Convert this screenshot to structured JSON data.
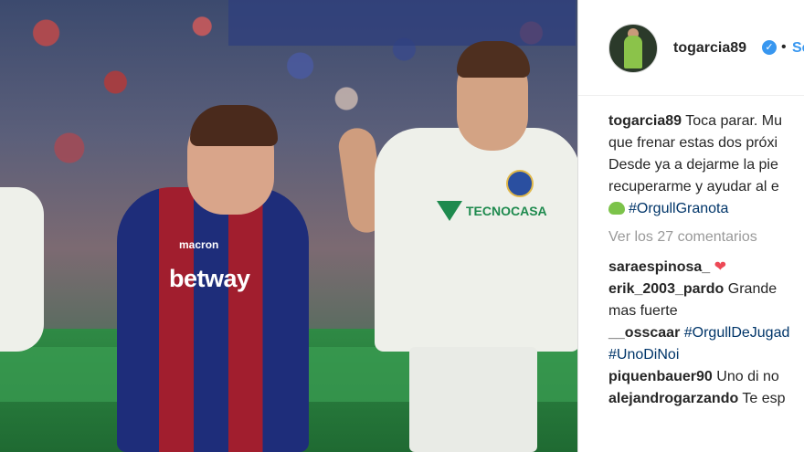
{
  "post": {
    "username": "togarcia89",
    "follow_label": "Se",
    "dot": "•",
    "caption_lines": [
      "Toca parar. Mu",
      "que frenar estas dos próxi",
      "Desde ya a dejarme la pie",
      "recuperarme y ayudar al e",
      "#OrgullGranota"
    ],
    "view_comments": "Ver los 27 comentarios"
  },
  "photo": {
    "left_sponsor": "betway",
    "left_kit_brand": "macron",
    "right_sponsor": "TECNOCASA"
  },
  "comments": [
    {
      "user": "saraespinosa_",
      "lines": [
        ""
      ],
      "heart": "❤"
    },
    {
      "user": "erik_2003_pardo",
      "lines": [
        "Grande",
        "mas fuerte"
      ]
    },
    {
      "user": "__osscaar",
      "lines": [
        "#OrgullDeJugad",
        "#UnoDiNoi"
      ]
    },
    {
      "user": "piquenbauer90",
      "lines": [
        "Uno di no"
      ]
    },
    {
      "user": "alejandrogarzando",
      "lines": [
        "Te esp"
      ]
    }
  ],
  "colors": {
    "link": "#3897f0",
    "hashtag": "#003569",
    "muted": "#999999",
    "text": "#262626"
  }
}
